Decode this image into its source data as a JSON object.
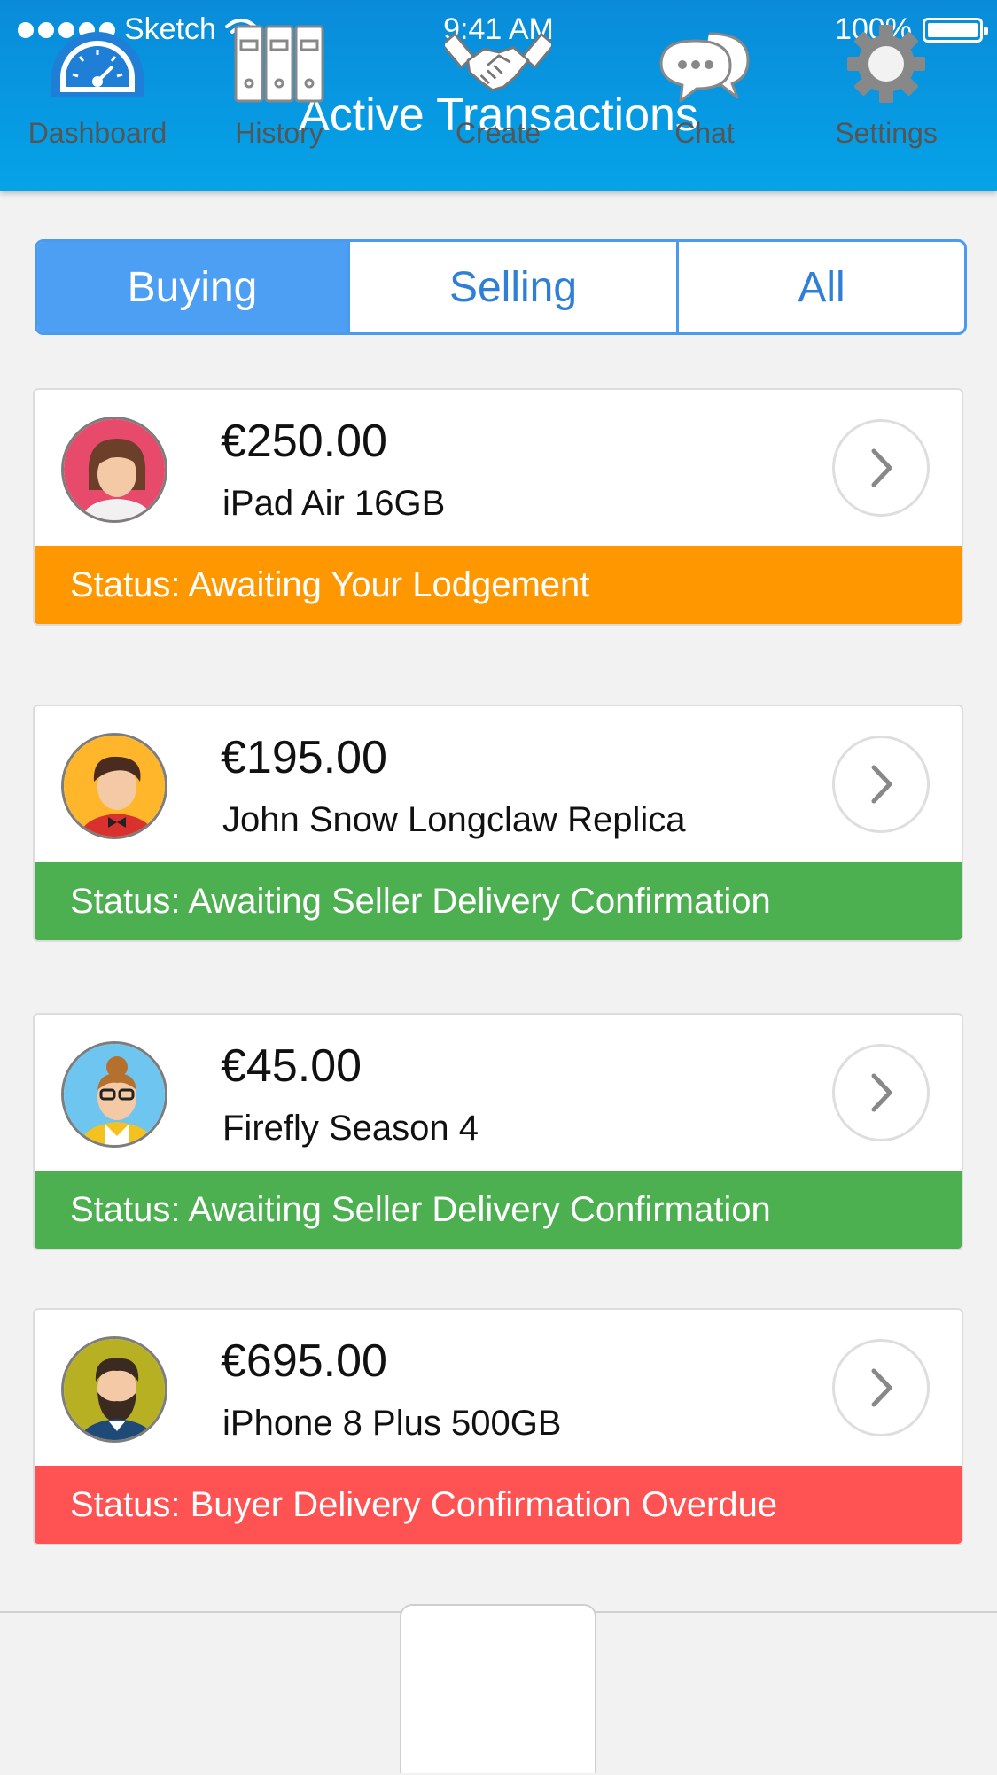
{
  "status_bar": {
    "carrier": "Sketch",
    "time": "9:41 AM",
    "battery": "100%"
  },
  "header": {
    "title": "Active Transactions"
  },
  "segments": [
    {
      "label": "Buying",
      "selected": true
    },
    {
      "label": "Selling",
      "selected": false
    },
    {
      "label": "All",
      "selected": false
    }
  ],
  "transactions": [
    {
      "price": "€250.00",
      "item": "iPad Air 16GB",
      "status": "Status: Awaiting Your Lodgement",
      "status_color": "#ff9800"
    },
    {
      "price": "€195.00",
      "item": "John Snow Longclaw Replica",
      "status": "Status: Awaiting Seller Delivery Confirmation",
      "status_color": "#4caf50"
    },
    {
      "price": "€45.00",
      "item": "Firefly Season 4",
      "status": "Status: Awaiting Seller Delivery Confirmation",
      "status_color": "#4caf50"
    },
    {
      "price": "€695.00",
      "item": "iPhone 8 Plus 500GB",
      "status": "Status: Buyer Delivery Confirmation Overdue",
      "status_color": "#ff5252"
    }
  ],
  "tabs": [
    {
      "label": "Dashboard",
      "icon": "speedometer-icon"
    },
    {
      "label": "History",
      "icon": "binders-icon"
    },
    {
      "label": "Create",
      "icon": "handshake-icon"
    },
    {
      "label": "Chat",
      "icon": "chat-bubbles-icon"
    },
    {
      "label": "Settings",
      "icon": "gear-icon"
    }
  ],
  "colors": {
    "header": "#0a8bd9",
    "accent": "#4c9ff2",
    "dashboard_icon": "#1f7fd6"
  }
}
